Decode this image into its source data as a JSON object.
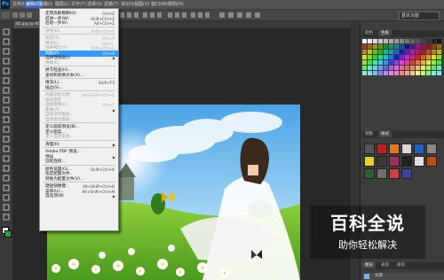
{
  "app": {
    "logo": "Ps",
    "workspace": "基本功能"
  },
  "menubar": [
    {
      "label": "文件(F)",
      "active": false
    },
    {
      "label": "编辑(E)",
      "active": true
    },
    {
      "label": "图像(I)",
      "active": false
    },
    {
      "label": "图层(L)",
      "active": false
    },
    {
      "label": "文字(Y)",
      "active": false
    },
    {
      "label": "选择(S)",
      "active": false
    },
    {
      "label": "滤镜(T)",
      "active": false
    },
    {
      "label": "3D(D)",
      "active": false
    },
    {
      "label": "视图(V)",
      "active": false
    },
    {
      "label": "窗口(W)",
      "active": false
    },
    {
      "label": "帮助(H)",
      "active": false
    }
  ],
  "document_tab": "3D.jpg @ 66.7%",
  "edit_menu": {
    "items": [
      {
        "label": "还原高斯模糊(O)",
        "shortcut": "Ctrl+Z",
        "disabled": false
      },
      {
        "label": "前进一步(W)",
        "shortcut": "Shift+Ctrl+Z",
        "disabled": false
      },
      {
        "label": "后退一步(K)",
        "shortcut": "Alt+Ctrl+Z",
        "disabled": false
      },
      {
        "sep": true
      },
      {
        "label": "渐隐(D)...",
        "shortcut": "Shift+Ctrl+F",
        "disabled": true
      },
      {
        "sep": true
      },
      {
        "label": "剪切(T)",
        "shortcut": "Ctrl+X",
        "disabled": true
      },
      {
        "label": "拷贝(C)",
        "shortcut": "Ctrl+C",
        "disabled": true
      },
      {
        "label": "合并拷贝(Y)",
        "shortcut": "Shift+Ctrl+C",
        "disabled": true
      },
      {
        "label": "粘贴(P)",
        "shortcut": "Ctrl+V",
        "disabled": false,
        "highlight": true
      },
      {
        "label": "选择性粘贴(I)",
        "arrow": true,
        "disabled": false
      },
      {
        "label": "清除(E)",
        "disabled": true
      },
      {
        "sep": true
      },
      {
        "label": "拼写检查(H)...",
        "disabled": false
      },
      {
        "label": "查找和替换文本(X)...",
        "disabled": false
      },
      {
        "sep": true
      },
      {
        "label": "填充(L)...",
        "shortcut": "Shift+F5",
        "disabled": false
      },
      {
        "label": "描边(S)...",
        "disabled": false
      },
      {
        "sep": true
      },
      {
        "label": "内容识别比例",
        "shortcut": "Alt+Shift+Ctrl+C",
        "disabled": true
      },
      {
        "label": "操控变形",
        "disabled": true
      },
      {
        "label": "自由变换(F)",
        "shortcut": "Ctrl+T",
        "disabled": true
      },
      {
        "label": "变换(A)",
        "arrow": true,
        "disabled": true
      },
      {
        "label": "自动对齐图层...",
        "disabled": true
      },
      {
        "label": "自动混合图层...",
        "disabled": true
      },
      {
        "sep": true
      },
      {
        "label": "定义画笔预设(B)...",
        "disabled": false
      },
      {
        "label": "定义图案...",
        "disabled": false
      },
      {
        "label": "定义自定形状...",
        "disabled": true
      },
      {
        "sep": true
      },
      {
        "label": "清理(R)",
        "arrow": true,
        "disabled": false
      },
      {
        "sep": true
      },
      {
        "label": "Adobe PDF 预设...",
        "disabled": false
      },
      {
        "label": "预设",
        "arrow": true,
        "disabled": false
      },
      {
        "label": "远程连接...",
        "disabled": false
      },
      {
        "sep": true
      },
      {
        "label": "颜色设置(G)...",
        "shortcut": "Shift+Ctrl+K",
        "disabled": false
      },
      {
        "label": "指定配置文件...",
        "disabled": false
      },
      {
        "label": "转换为配置文件(V)...",
        "disabled": false
      },
      {
        "sep": true
      },
      {
        "label": "键盘快捷键...",
        "shortcut": "Alt+Shift+Ctrl+K",
        "disabled": false
      },
      {
        "label": "菜单(U)...",
        "shortcut": "Alt+Shift+Ctrl+M",
        "disabled": false
      },
      {
        "label": "首选项(N)",
        "arrow": true,
        "disabled": false
      }
    ]
  },
  "panels": {
    "top_tabs": [
      "颜色",
      "色板"
    ],
    "mid_tabs": [
      "调整",
      "样式"
    ],
    "bottom_tabs": [
      "图层",
      "通道",
      "路径"
    ],
    "layer_name": "背景"
  },
  "watermark": {
    "title": "百科全说",
    "subtitle": "助你轻松解决"
  },
  "colors": {
    "menu_highlight": "#3399ff",
    "menubar_active": "#3366cc",
    "ui_dark": "#282828"
  },
  "icons": [
    "move-icon",
    "marquee-icon",
    "lasso-icon",
    "magic-wand-icon",
    "crop-icon",
    "eyedropper-icon",
    "healing-icon",
    "brush-icon",
    "stamp-icon",
    "history-brush-icon",
    "eraser-icon",
    "gradient-icon",
    "blur-icon",
    "dodge-icon",
    "pen-icon",
    "type-icon",
    "path-select-icon",
    "shape-icon",
    "hand-icon",
    "zoom-icon"
  ]
}
